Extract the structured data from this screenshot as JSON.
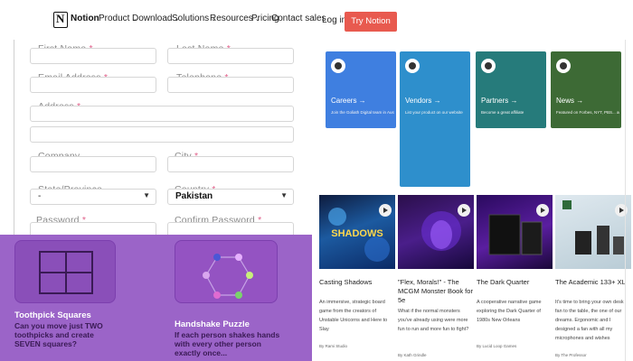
{
  "nav": {
    "brand": "Notion",
    "items": [
      "Product",
      "Download",
      "Solutions",
      "Resources",
      "Pricing"
    ],
    "contact": "Contact sales",
    "login": "Log in",
    "cta": "Try Notion free"
  },
  "form": {
    "first_name": "First Name",
    "last_name": "Last Name",
    "email": "Email Address",
    "telephone": "Telephone",
    "address": "Address",
    "company": "Company",
    "city": "City",
    "state": "State/Province",
    "state_value": "-",
    "country": "Country",
    "country_value": "Pakistan",
    "password": "Password",
    "confirm_password": "Confirm Password",
    "required_mark": "*"
  },
  "puzzles": [
    {
      "title": "Toothpick Squares",
      "desc": "Can you move just TWO toothpicks and create SEVEN squares?"
    },
    {
      "title": "Handshake Puzzle",
      "desc": "If each person shakes hands with every other person exactly once..."
    }
  ],
  "tiles": [
    {
      "title": "Careers →",
      "desc": "Join the Goliath Digital team in Austin",
      "color": "#3f7fe0"
    },
    {
      "title": "Vendors →",
      "desc": "List your product on our website",
      "color": "#2e8fcc"
    },
    {
      "title": "Partners →",
      "desc": "Become a great affiliate",
      "color": "#267b7b"
    },
    {
      "title": "News →",
      "desc": "Featured on Forbes, NYT, PBS... and more",
      "color": "#3d6a35"
    }
  ],
  "cards": [
    {
      "title": "Casting Shadows",
      "desc": "An immersive, strategic board game from the creators of Unstable Unicorns and Here to Slay",
      "by": "By Rami Studio"
    },
    {
      "title": "\"Flex, Morals!\" - The MCGM Monster Book for 5e",
      "desc": "What if the normal monsters you've already using were more fun to run and more fun to fight?",
      "by": "By Kath Grindle"
    },
    {
      "title": "The Dark Quarter",
      "desc": "A cooperative narrative game exploring the Dark Quarter of 1980s New Orleans",
      "by": "By Lucid Loop Games"
    },
    {
      "title": "The Academic 133+ XL",
      "desc": "It's time to bring your own desk fan to the table, the one of our dreams. Ergonomic and I designed a fan with all my microphones and wishes",
      "by": "By The Professor"
    }
  ],
  "colors": {
    "cta": "#e85a4f",
    "puzzle_bg": "#9b64c8"
  }
}
